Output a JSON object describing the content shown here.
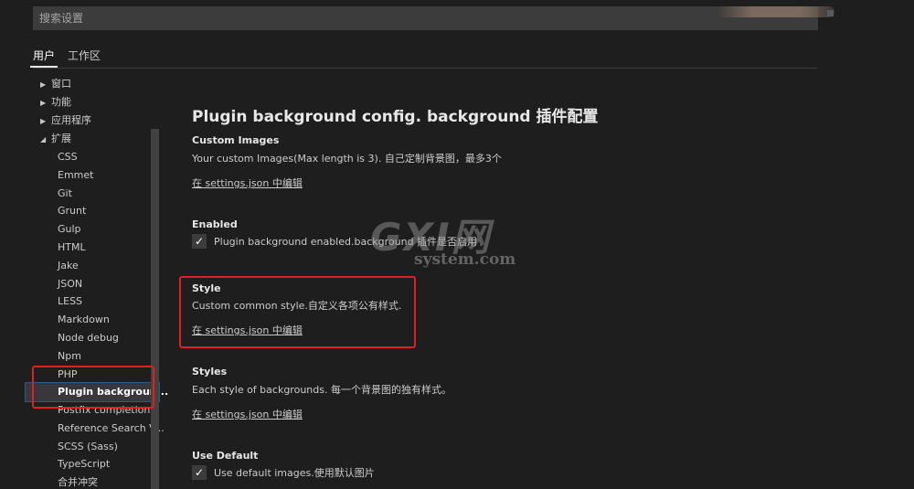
{
  "search": {
    "placeholder": "搜索设置"
  },
  "tabs": [
    {
      "label": "用户",
      "active": true
    },
    {
      "label": "工作区",
      "active": false
    }
  ],
  "tree": {
    "top_items": [
      {
        "label": "窗口",
        "expanded": false
      },
      {
        "label": "功能",
        "expanded": false
      },
      {
        "label": "应用程序",
        "expanded": false
      },
      {
        "label": "扩展",
        "expanded": true
      }
    ],
    "extensions": [
      "CSS",
      "Emmet",
      "Git",
      "Grunt",
      "Gulp",
      "HTML",
      "Jake",
      "JSON",
      "LESS",
      "Markdown",
      "Node debug",
      "Npm",
      "PHP",
      "Plugin backgroun...",
      "Postfix completion",
      "Reference Search V...",
      "SCSS (Sass)",
      "TypeScript",
      "合并冲突"
    ],
    "selected": "Plugin backgroun..."
  },
  "content": {
    "section_title": "Plugin background config. background 插件配置",
    "settings": {
      "custom_images": {
        "title": "Custom Images",
        "description": "Your custom Images(Max length is 3). 自己定制背景图，最多3个",
        "link": "在 settings.json 中编辑"
      },
      "enabled": {
        "title": "Enabled",
        "checkbox_label": "Plugin background enabled.background 插件是否启用",
        "checked": true
      },
      "style": {
        "title": "Style",
        "description": "Custom common style.自定义各项公有样式.",
        "link": "在 settings.json 中编辑"
      },
      "styles": {
        "title": "Styles",
        "description": "Each style of backgrounds. 每一个背景图的独有样式。",
        "link": "在 settings.json 中编辑"
      },
      "use_default": {
        "title": "Use Default",
        "checkbox_label": "Use default images.使用默认图片",
        "checked": true
      }
    }
  },
  "watermark": {
    "main": "GXI网",
    "sub": "system.com"
  },
  "colors": {
    "background": "#1e1e1e",
    "input_bg": "#3c3c3c",
    "annotation_red": "#e02020",
    "selected_bg": "#37373d"
  },
  "icons": {
    "check": "check-icon",
    "collapsed": "chevron-right-icon",
    "expanded": "chevron-down-icon"
  }
}
